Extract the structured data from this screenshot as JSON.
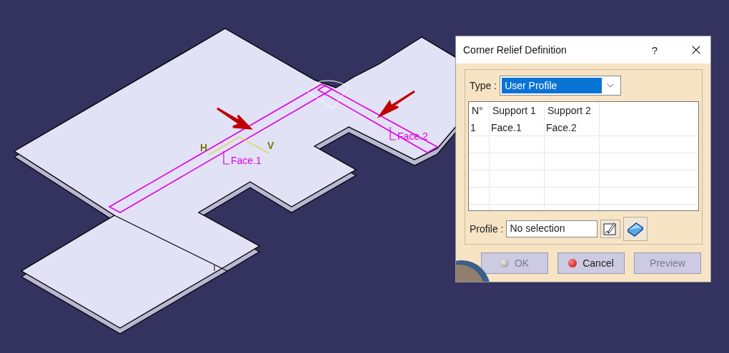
{
  "viewport": {
    "labels": [
      {
        "kind": "face",
        "text": "Face.1"
      },
      {
        "kind": "face",
        "text": "Face.2"
      },
      {
        "kind": "axis",
        "text": "V"
      },
      {
        "kind": "axis",
        "text": "H"
      }
    ]
  },
  "dialog": {
    "title": "Corner Relief Definition",
    "help": "?",
    "type_label": "Type :",
    "type_value": "User Profile",
    "table": {
      "columns": [
        "N°",
        "Support 1",
        "Support 2"
      ],
      "rows": [
        [
          "1",
          "Face.1",
          "Face.2"
        ]
      ]
    },
    "profile_label": "Profile :",
    "profile_value": "No selection",
    "buttons": [
      {
        "label": "OK",
        "disabled": true,
        "kind": "bullet"
      },
      {
        "label": "Cancel",
        "disabled": false,
        "kind": "bullet"
      },
      {
        "label": "Preview",
        "disabled": true,
        "kind": "plain"
      }
    ]
  }
}
